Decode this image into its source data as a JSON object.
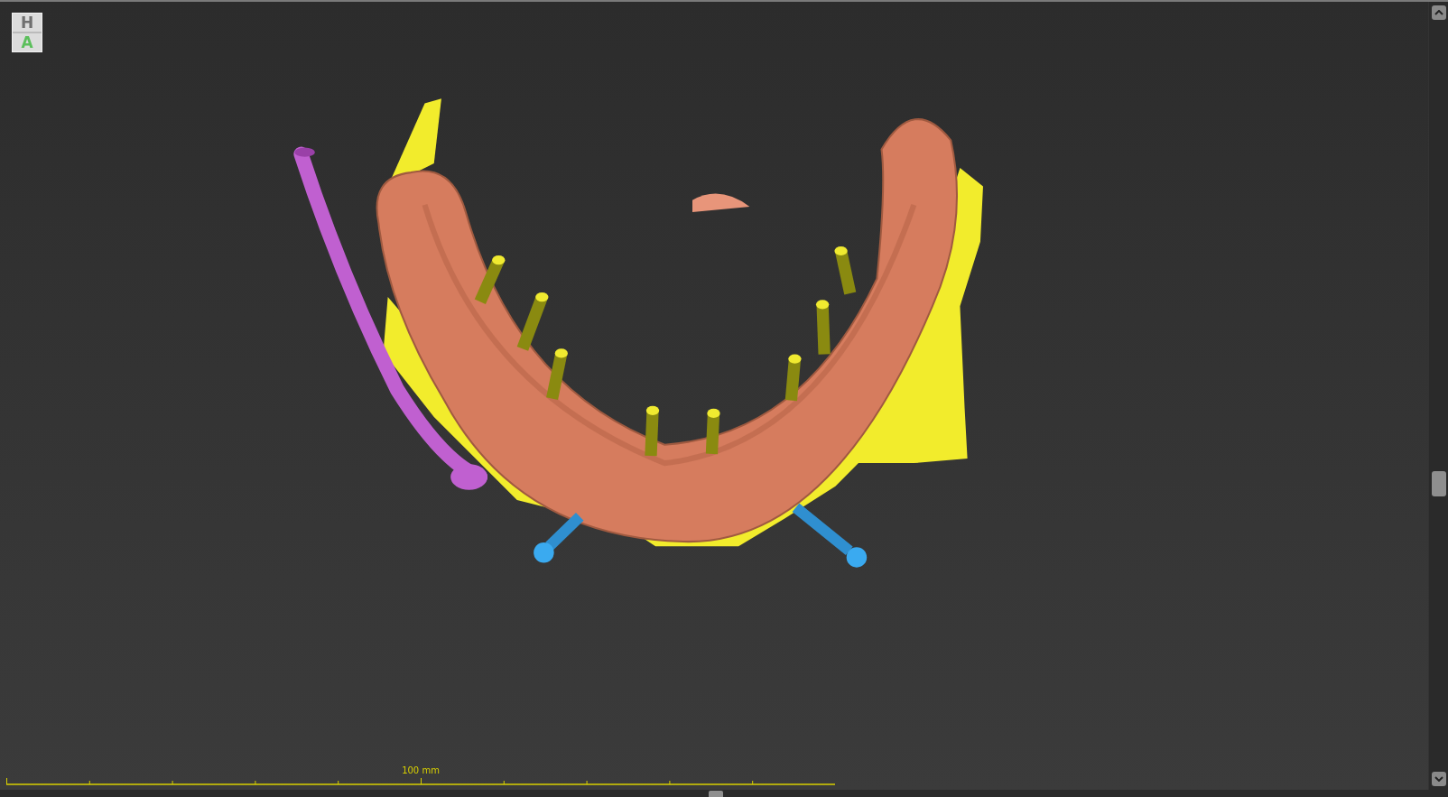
{
  "logo": {
    "top": "H",
    "bottom": "A"
  },
  "scale_bar": {
    "label": "100 mm"
  }
}
